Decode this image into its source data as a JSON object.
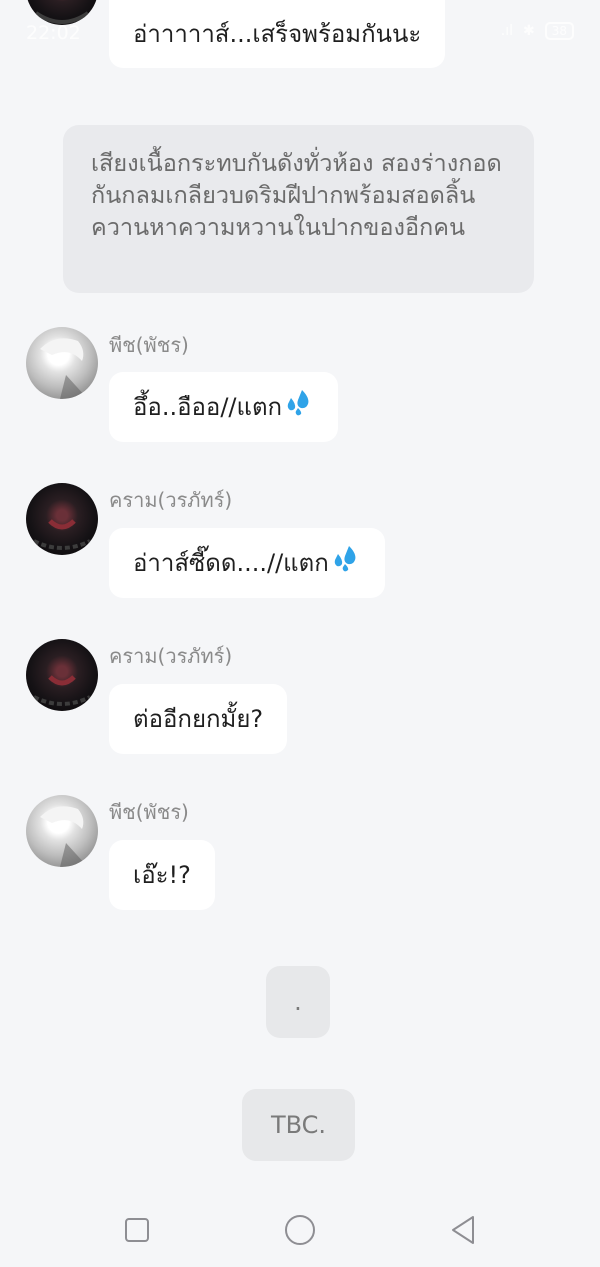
{
  "status_bar": {
    "time": "22:02",
    "signal": ".ıl",
    "battery": "38"
  },
  "messages": {
    "top": {
      "text": "อ่าาาาาส์...เสร็จพร้อมกันนะ"
    },
    "narration": {
      "text": "เสียงเนื้อกระทบกันดังทั่วห้อง สองร่างกอดกันกลมเกลียวบดริมฝีปากพร้อมสอดลิ้นควานหาความหวานในปากของอีกคน"
    },
    "m1": {
      "sender": "พีช(พัชร)",
      "text": "อึ้อ..อืออ//แตก"
    },
    "m2": {
      "sender": "คราม(วรภัทร์)",
      "text": "อ่าาส์ซี๊ดด....//แตก"
    },
    "m3": {
      "sender": "คราม(วรภัทร์)",
      "text": "ต่ออีกยกมั้ย?"
    },
    "m4": {
      "sender": "พีช(พัชร)",
      "text": "เอ๊ะ!?"
    },
    "dot": {
      "text": "."
    },
    "tbc": {
      "text": "TBC."
    }
  },
  "icons": {
    "droplets": "sweat-droplets-icon",
    "nav_square": "recent-apps-icon",
    "nav_circle": "home-icon",
    "nav_triangle": "back-icon"
  },
  "colors": {
    "background": "#f5f6f8",
    "bubble": "#ffffff",
    "narration": "#e9eaed",
    "sender": "#8a8a8a",
    "droplet": "#2fa3e8"
  }
}
